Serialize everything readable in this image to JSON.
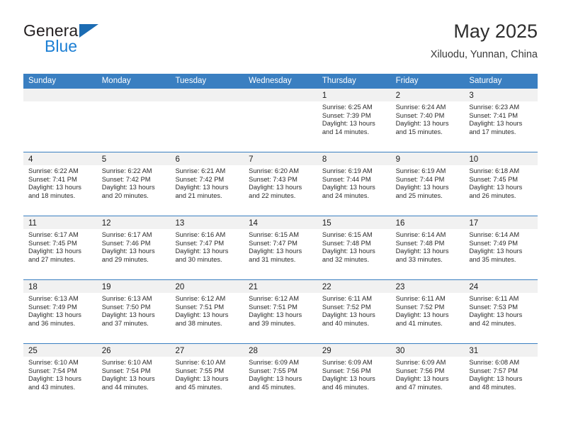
{
  "brand": {
    "word_one": "General",
    "word_two": "Blue",
    "accent_dark": "#1c6cb3",
    "accent_light": "#1c7fd4"
  },
  "header": {
    "title": "May 2025",
    "subtitle": "Xiluodu, Yunnan, China"
  },
  "theme": {
    "header_blue": "#3a7fc1",
    "daynum_band": "#f1f1f1",
    "text": "#2b2b2b"
  },
  "weekdays": [
    "Sunday",
    "Monday",
    "Tuesday",
    "Wednesday",
    "Thursday",
    "Friday",
    "Saturday"
  ],
  "weeks": [
    [
      {
        "day": "",
        "sunrise": "",
        "sunset": "",
        "daylight_line1": "",
        "daylight_line2": ""
      },
      {
        "day": "",
        "sunrise": "",
        "sunset": "",
        "daylight_line1": "",
        "daylight_line2": ""
      },
      {
        "day": "",
        "sunrise": "",
        "sunset": "",
        "daylight_line1": "",
        "daylight_line2": ""
      },
      {
        "day": "",
        "sunrise": "",
        "sunset": "",
        "daylight_line1": "",
        "daylight_line2": ""
      },
      {
        "day": "1",
        "sunrise": "Sunrise: 6:25 AM",
        "sunset": "Sunset: 7:39 PM",
        "daylight_line1": "Daylight: 13 hours",
        "daylight_line2": "and 14 minutes."
      },
      {
        "day": "2",
        "sunrise": "Sunrise: 6:24 AM",
        "sunset": "Sunset: 7:40 PM",
        "daylight_line1": "Daylight: 13 hours",
        "daylight_line2": "and 15 minutes."
      },
      {
        "day": "3",
        "sunrise": "Sunrise: 6:23 AM",
        "sunset": "Sunset: 7:41 PM",
        "daylight_line1": "Daylight: 13 hours",
        "daylight_line2": "and 17 minutes."
      }
    ],
    [
      {
        "day": "4",
        "sunrise": "Sunrise: 6:22 AM",
        "sunset": "Sunset: 7:41 PM",
        "daylight_line1": "Daylight: 13 hours",
        "daylight_line2": "and 18 minutes."
      },
      {
        "day": "5",
        "sunrise": "Sunrise: 6:22 AM",
        "sunset": "Sunset: 7:42 PM",
        "daylight_line1": "Daylight: 13 hours",
        "daylight_line2": "and 20 minutes."
      },
      {
        "day": "6",
        "sunrise": "Sunrise: 6:21 AM",
        "sunset": "Sunset: 7:42 PM",
        "daylight_line1": "Daylight: 13 hours",
        "daylight_line2": "and 21 minutes."
      },
      {
        "day": "7",
        "sunrise": "Sunrise: 6:20 AM",
        "sunset": "Sunset: 7:43 PM",
        "daylight_line1": "Daylight: 13 hours",
        "daylight_line2": "and 22 minutes."
      },
      {
        "day": "8",
        "sunrise": "Sunrise: 6:19 AM",
        "sunset": "Sunset: 7:44 PM",
        "daylight_line1": "Daylight: 13 hours",
        "daylight_line2": "and 24 minutes."
      },
      {
        "day": "9",
        "sunrise": "Sunrise: 6:19 AM",
        "sunset": "Sunset: 7:44 PM",
        "daylight_line1": "Daylight: 13 hours",
        "daylight_line2": "and 25 minutes."
      },
      {
        "day": "10",
        "sunrise": "Sunrise: 6:18 AM",
        "sunset": "Sunset: 7:45 PM",
        "daylight_line1": "Daylight: 13 hours",
        "daylight_line2": "and 26 minutes."
      }
    ],
    [
      {
        "day": "11",
        "sunrise": "Sunrise: 6:17 AM",
        "sunset": "Sunset: 7:45 PM",
        "daylight_line1": "Daylight: 13 hours",
        "daylight_line2": "and 27 minutes."
      },
      {
        "day": "12",
        "sunrise": "Sunrise: 6:17 AM",
        "sunset": "Sunset: 7:46 PM",
        "daylight_line1": "Daylight: 13 hours",
        "daylight_line2": "and 29 minutes."
      },
      {
        "day": "13",
        "sunrise": "Sunrise: 6:16 AM",
        "sunset": "Sunset: 7:47 PM",
        "daylight_line1": "Daylight: 13 hours",
        "daylight_line2": "and 30 minutes."
      },
      {
        "day": "14",
        "sunrise": "Sunrise: 6:15 AM",
        "sunset": "Sunset: 7:47 PM",
        "daylight_line1": "Daylight: 13 hours",
        "daylight_line2": "and 31 minutes."
      },
      {
        "day": "15",
        "sunrise": "Sunrise: 6:15 AM",
        "sunset": "Sunset: 7:48 PM",
        "daylight_line1": "Daylight: 13 hours",
        "daylight_line2": "and 32 minutes."
      },
      {
        "day": "16",
        "sunrise": "Sunrise: 6:14 AM",
        "sunset": "Sunset: 7:48 PM",
        "daylight_line1": "Daylight: 13 hours",
        "daylight_line2": "and 33 minutes."
      },
      {
        "day": "17",
        "sunrise": "Sunrise: 6:14 AM",
        "sunset": "Sunset: 7:49 PM",
        "daylight_line1": "Daylight: 13 hours",
        "daylight_line2": "and 35 minutes."
      }
    ],
    [
      {
        "day": "18",
        "sunrise": "Sunrise: 6:13 AM",
        "sunset": "Sunset: 7:49 PM",
        "daylight_line1": "Daylight: 13 hours",
        "daylight_line2": "and 36 minutes."
      },
      {
        "day": "19",
        "sunrise": "Sunrise: 6:13 AM",
        "sunset": "Sunset: 7:50 PM",
        "daylight_line1": "Daylight: 13 hours",
        "daylight_line2": "and 37 minutes."
      },
      {
        "day": "20",
        "sunrise": "Sunrise: 6:12 AM",
        "sunset": "Sunset: 7:51 PM",
        "daylight_line1": "Daylight: 13 hours",
        "daylight_line2": "and 38 minutes."
      },
      {
        "day": "21",
        "sunrise": "Sunrise: 6:12 AM",
        "sunset": "Sunset: 7:51 PM",
        "daylight_line1": "Daylight: 13 hours",
        "daylight_line2": "and 39 minutes."
      },
      {
        "day": "22",
        "sunrise": "Sunrise: 6:11 AM",
        "sunset": "Sunset: 7:52 PM",
        "daylight_line1": "Daylight: 13 hours",
        "daylight_line2": "and 40 minutes."
      },
      {
        "day": "23",
        "sunrise": "Sunrise: 6:11 AM",
        "sunset": "Sunset: 7:52 PM",
        "daylight_line1": "Daylight: 13 hours",
        "daylight_line2": "and 41 minutes."
      },
      {
        "day": "24",
        "sunrise": "Sunrise: 6:11 AM",
        "sunset": "Sunset: 7:53 PM",
        "daylight_line1": "Daylight: 13 hours",
        "daylight_line2": "and 42 minutes."
      }
    ],
    [
      {
        "day": "25",
        "sunrise": "Sunrise: 6:10 AM",
        "sunset": "Sunset: 7:54 PM",
        "daylight_line1": "Daylight: 13 hours",
        "daylight_line2": "and 43 minutes."
      },
      {
        "day": "26",
        "sunrise": "Sunrise: 6:10 AM",
        "sunset": "Sunset: 7:54 PM",
        "daylight_line1": "Daylight: 13 hours",
        "daylight_line2": "and 44 minutes."
      },
      {
        "day": "27",
        "sunrise": "Sunrise: 6:10 AM",
        "sunset": "Sunset: 7:55 PM",
        "daylight_line1": "Daylight: 13 hours",
        "daylight_line2": "and 45 minutes."
      },
      {
        "day": "28",
        "sunrise": "Sunrise: 6:09 AM",
        "sunset": "Sunset: 7:55 PM",
        "daylight_line1": "Daylight: 13 hours",
        "daylight_line2": "and 45 minutes."
      },
      {
        "day": "29",
        "sunrise": "Sunrise: 6:09 AM",
        "sunset": "Sunset: 7:56 PM",
        "daylight_line1": "Daylight: 13 hours",
        "daylight_line2": "and 46 minutes."
      },
      {
        "day": "30",
        "sunrise": "Sunrise: 6:09 AM",
        "sunset": "Sunset: 7:56 PM",
        "daylight_line1": "Daylight: 13 hours",
        "daylight_line2": "and 47 minutes."
      },
      {
        "day": "31",
        "sunrise": "Sunrise: 6:08 AM",
        "sunset": "Sunset: 7:57 PM",
        "daylight_line1": "Daylight: 13 hours",
        "daylight_line2": "and 48 minutes."
      }
    ]
  ]
}
